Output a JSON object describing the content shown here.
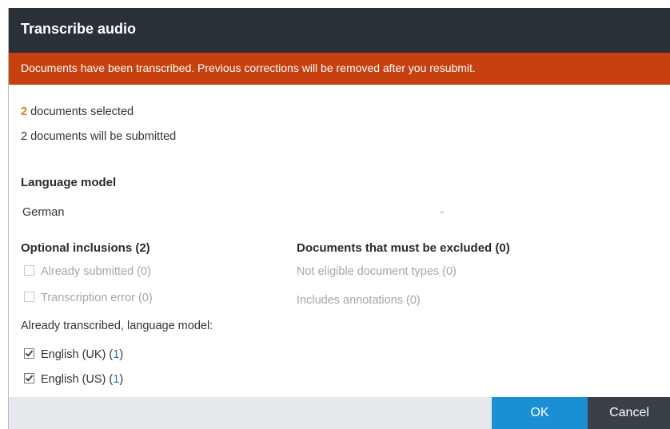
{
  "dialog": {
    "title": "Transcribe audio",
    "banner": "Documents have been transcribed. Previous corrections will be removed after you resubmit.",
    "selected_count": "2",
    "selected_suffix": " documents selected",
    "will_submit": "2 documents will be submitted",
    "language_model_heading": "Language model",
    "language_model_value": "German",
    "optional_heading": "Optional inclusions (2)",
    "optional_items": [
      {
        "label": "Already submitted (0)",
        "checked": false
      },
      {
        "label": "Transcription error (0)",
        "checked": false
      }
    ],
    "already_transcribed_label": "Already transcribed, language model:",
    "transcribed_items": [
      {
        "label": "English (UK)",
        "open": " (",
        "count": "1",
        "close": ")",
        "checked": true
      },
      {
        "label": "English (US)",
        "open": " (",
        "count": "1",
        "close": ")",
        "checked": true
      }
    ],
    "excluded_heading": "Documents that must be excluded (0)",
    "excluded_items": [
      "Not eligible document types (0)",
      "Includes annotations (0)"
    ],
    "ok_label": "OK",
    "cancel_label": "Cancel"
  },
  "colors": {
    "titlebar": "#2a3038",
    "banner": "#c7400f",
    "count": "#e07b18",
    "link": "#1f74c6",
    "ok_button": "#1b8fd3",
    "cancel_button": "#3a4048",
    "footer": "#e5e8ec"
  },
  "icons": {
    "select_chevron": "chevron-down-icon",
    "checkbox": "checkbox-icon"
  }
}
